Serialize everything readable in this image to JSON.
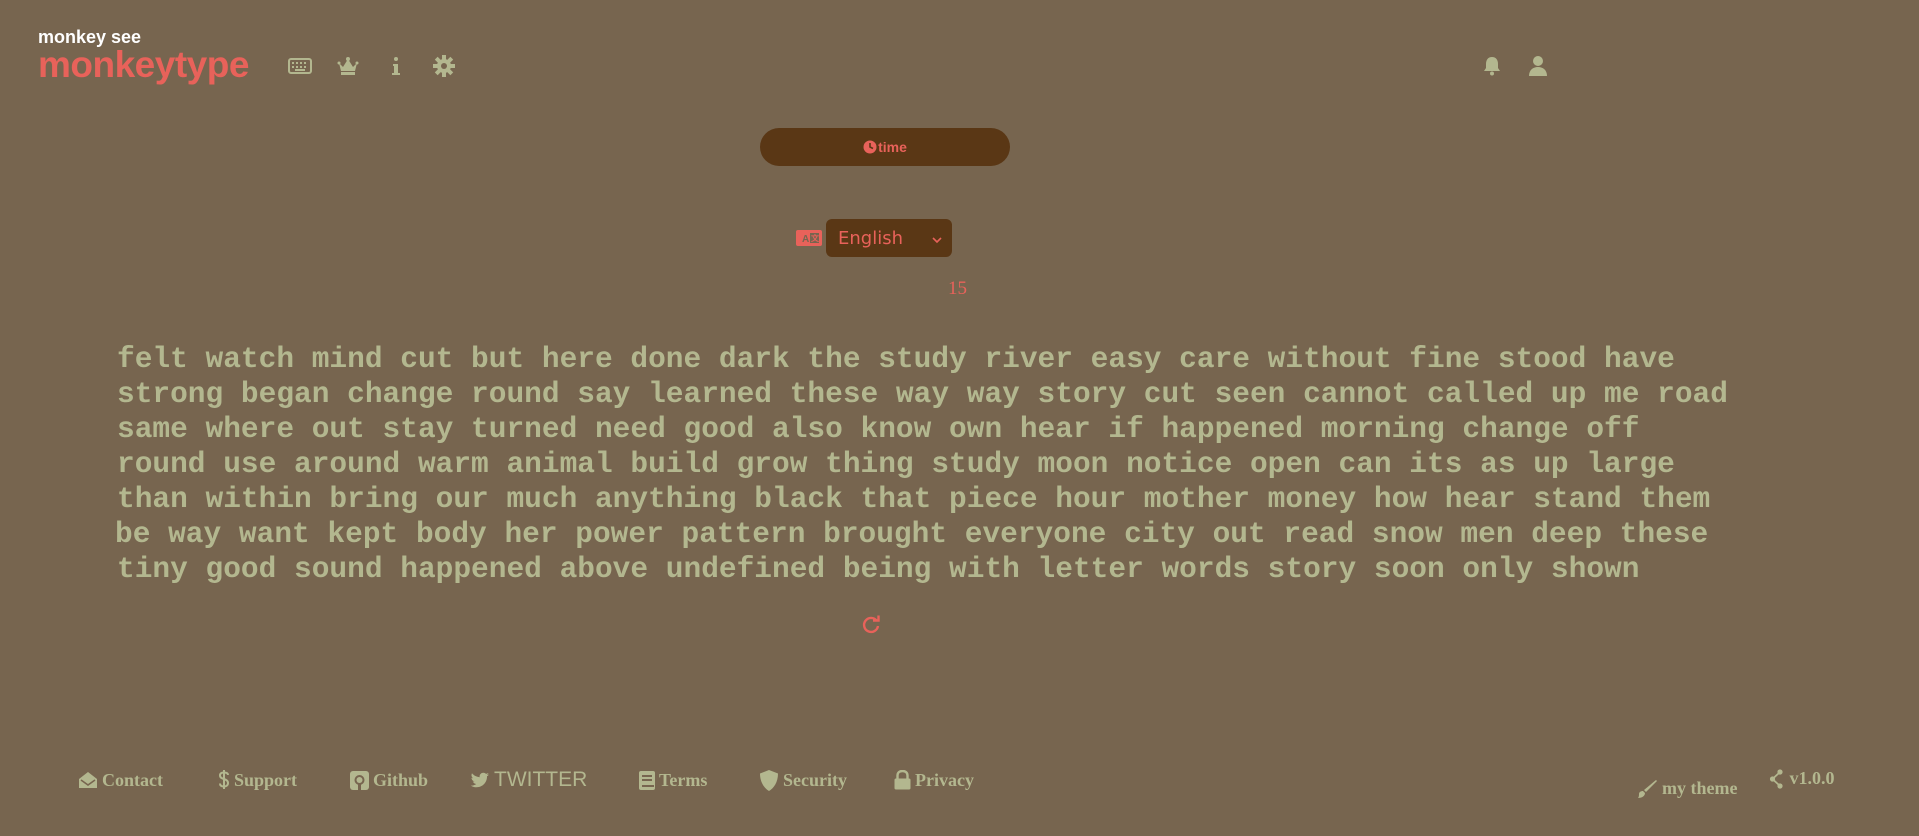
{
  "header": {
    "tagline": "monkey see",
    "logo": "monkeytype",
    "nav_icons": [
      "keyboard-icon",
      "crown-icon",
      "info-icon",
      "gear-icon"
    ],
    "right_icons": [
      "bell-icon",
      "user-icon"
    ]
  },
  "mode": {
    "icon": "clock-icon",
    "label": "time"
  },
  "language": {
    "icon": "language-icon",
    "selected": "English"
  },
  "timer": "15",
  "words": {
    "lines": [
      "felt watch mind cut but here done dark the study river easy care without fine stood have",
      "strong began change round say learned these way way story cut seen cannot called up me road",
      "same where out stay turned need good also know own hear if happened morning change off",
      "round use around warm animal build grow thing study moon notice open can its as up large",
      "than within bring our much anything black that piece hour mother money how hear stand them",
      "be way want kept body her power pattern brought everyone city out read snow men deep these",
      "tiny good sound happened above undefined being with letter words story soon only shown"
    ]
  },
  "restart": {
    "icon": "refresh-icon"
  },
  "footer": {
    "links": [
      {
        "icon": "envelope-icon",
        "label": "Contact"
      },
      {
        "icon": "dollar-icon",
        "label": "Support"
      },
      {
        "icon": "github-icon",
        "label": "Github"
      },
      {
        "icon": "twitter-icon",
        "label": "TWITTER"
      },
      {
        "icon": "book-icon",
        "label": "Terms"
      },
      {
        "icon": "shield-icon",
        "label": "Security"
      },
      {
        "icon": "lock-icon",
        "label": "Privacy"
      }
    ],
    "theme": {
      "icon": "brush-icon",
      "label": "my theme"
    },
    "version": {
      "icon": "code-branch-icon",
      "label": "v1.0.0"
    }
  },
  "colors": {
    "background": "#77654f",
    "accent": "#e8625a",
    "text": "#b3b78f",
    "pill": "#5a3715"
  }
}
